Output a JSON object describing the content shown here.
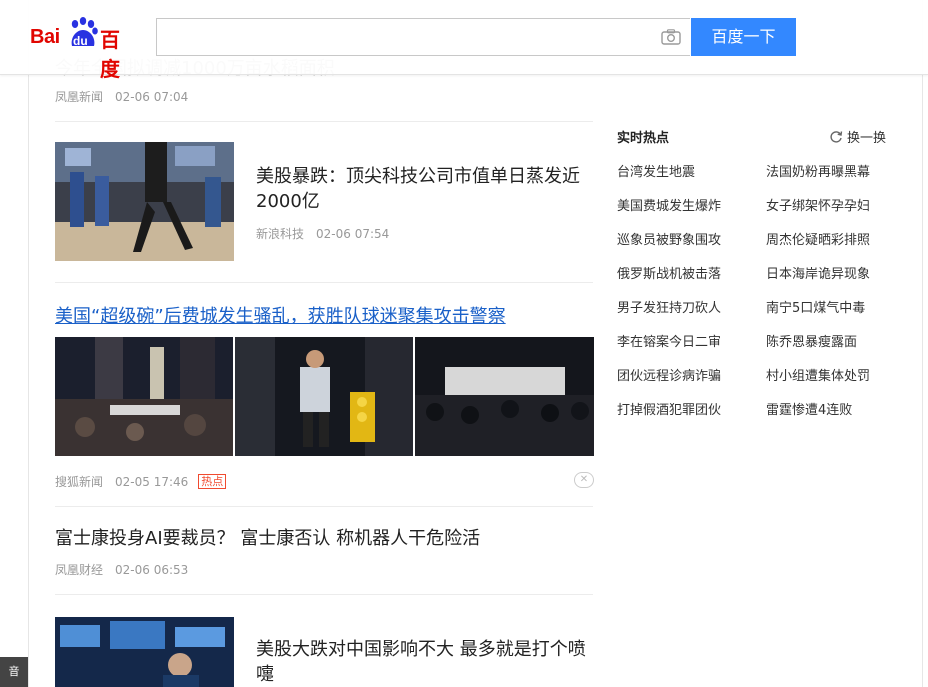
{
  "header": {
    "logo_text_latin": "Bai",
    "logo_text_du": "du",
    "logo_text_cn": "百度",
    "search_value": "",
    "search_button": "百度一下",
    "brand_color": "#e10601",
    "button_color": "#3388ff"
  },
  "feed": {
    "ghost_item": {
      "title": "今年全国拟调减1000万亩水稻面积",
      "source": "凤凰新闻",
      "time": "02-06 07:04"
    },
    "item1": {
      "title": "美股暴跌：顶尖科技公司市值单日蒸发近2000亿",
      "source": "新浪科技",
      "time": "02-06 07:54"
    },
    "item2": {
      "title": "美国“超级碗”后费城发生骚乱，获胜队球迷聚集攻击警察",
      "source": "搜狐新闻",
      "time": "02-05 17:46",
      "badge": "热点"
    },
    "item3": {
      "title": "富士康投身AI要裁员？ 富士康否认 称机器人干危险活",
      "source": "凤凰财经",
      "time": "02-06 06:53"
    },
    "item4": {
      "title": "美股大跌对中国影响不大 最多就是打个喷嚏"
    }
  },
  "hot": {
    "title": "实时热点",
    "refresh_label": "换一换",
    "items": [
      "台湾发生地震",
      "法国奶粉再曝黑幕",
      "美国费城发生爆炸",
      "女子绑架怀孕孕妇",
      "巡象员被野象围攻",
      "周杰伦疑晒彩排照",
      "俄罗斯战机被击落",
      "日本海岸诡异现象",
      "男子发狂持刀砍人",
      "南宁5口煤气中毒",
      "李在镕案今日二审",
      "陈乔恩暴瘦露面",
      "团伙远程诊病诈骗",
      "村小组遭集体处罚",
      "打掉假酒犯罪团伙",
      "雷霆惨遭4连败"
    ]
  },
  "corner_tab": "音"
}
